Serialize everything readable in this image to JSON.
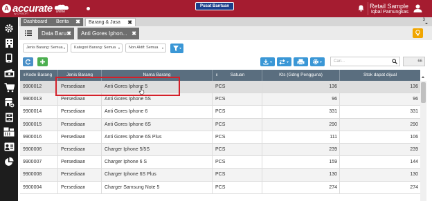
{
  "app": {
    "logo_text": "accurate",
    "logo_online": "online",
    "logo_sub": "by CPSSOFT",
    "help_label": "Pusat Bantuan",
    "org": "Retail Sample",
    "user": "Iqbal Pamungkas"
  },
  "sidebar": {
    "items": [
      {
        "icon": "gear-icon"
      },
      {
        "icon": "building-icon"
      },
      {
        "icon": "mobile-icon"
      },
      {
        "icon": "money-icon"
      },
      {
        "icon": "cart-icon"
      },
      {
        "icon": "shop-add-icon"
      },
      {
        "icon": "warehouse-icon"
      },
      {
        "icon": "cashier-icon"
      },
      {
        "icon": "account-icon"
      },
      {
        "icon": "pie-chart-icon"
      }
    ]
  },
  "tabs": {
    "items": [
      {
        "label": "Dashboard"
      },
      {
        "label": "Berita",
        "close": "✖"
      },
      {
        "label": "Barang & Jasa",
        "close": "✖"
      }
    ],
    "count": "3"
  },
  "subtabs": {
    "items": [
      {
        "label": "Data Baru",
        "close": "✖"
      },
      {
        "label": "Anti Gores Iphon...",
        "close": "✖"
      }
    ]
  },
  "filters": [
    {
      "label": "Jenis Barang: Semua"
    },
    {
      "label": "Kategori Barang: Semua"
    },
    {
      "label": "Non Aktif: Semua"
    }
  ],
  "search": {
    "placeholder": "Cari..."
  },
  "record_count": "66",
  "table": {
    "headers": [
      "Kode Barang",
      "Jenis Barang",
      "Nama Barang",
      "Satuan",
      "Kts (Gdng Pengguna)",
      "Stok dapat dijual"
    ],
    "rows": [
      {
        "code": "9900012",
        "type": "Persediaan",
        "name": "Anti Gores Iphone 5",
        "unit": "PCS",
        "qty": "136",
        "stock": "136"
      },
      {
        "code": "9900013",
        "type": "Persediaan",
        "name": "Anti Gores Iphone 5S",
        "unit": "PCS",
        "qty": "96",
        "stock": "96"
      },
      {
        "code": "9900014",
        "type": "Persediaan",
        "name": "Anti Gores Iphone 6",
        "unit": "PCS",
        "qty": "331",
        "stock": "331"
      },
      {
        "code": "9900015",
        "type": "Persediaan",
        "name": "Anti Gores Iphone 6S",
        "unit": "PCS",
        "qty": "290",
        "stock": "290"
      },
      {
        "code": "9900016",
        "type": "Persediaan",
        "name": "Anti Gores Iphone 6S Plus",
        "unit": "PCS",
        "qty": "111",
        "stock": "106"
      },
      {
        "code": "9900006",
        "type": "Persediaan",
        "name": "Charger Iphone 5/5S",
        "unit": "PCS",
        "qty": "239",
        "stock": "239"
      },
      {
        "code": "9900007",
        "type": "Persediaan",
        "name": "Charger Iphone 6 S",
        "unit": "PCS",
        "qty": "159",
        "stock": "144"
      },
      {
        "code": "9900008",
        "type": "Persediaan",
        "name": "Charger Iphone 6S Plus",
        "unit": "PCS",
        "qty": "130",
        "stock": "130"
      },
      {
        "code": "9900004",
        "type": "Persediaan",
        "name": "Charger Samsung Note 5",
        "unit": "PCS",
        "qty": "274",
        "stock": "274"
      }
    ]
  },
  "colors": {
    "brand": "#a51c30",
    "header": "#5a6e7f",
    "primary": "#3a97d6",
    "green": "#4caf50",
    "highlight": "#d4202a"
  }
}
